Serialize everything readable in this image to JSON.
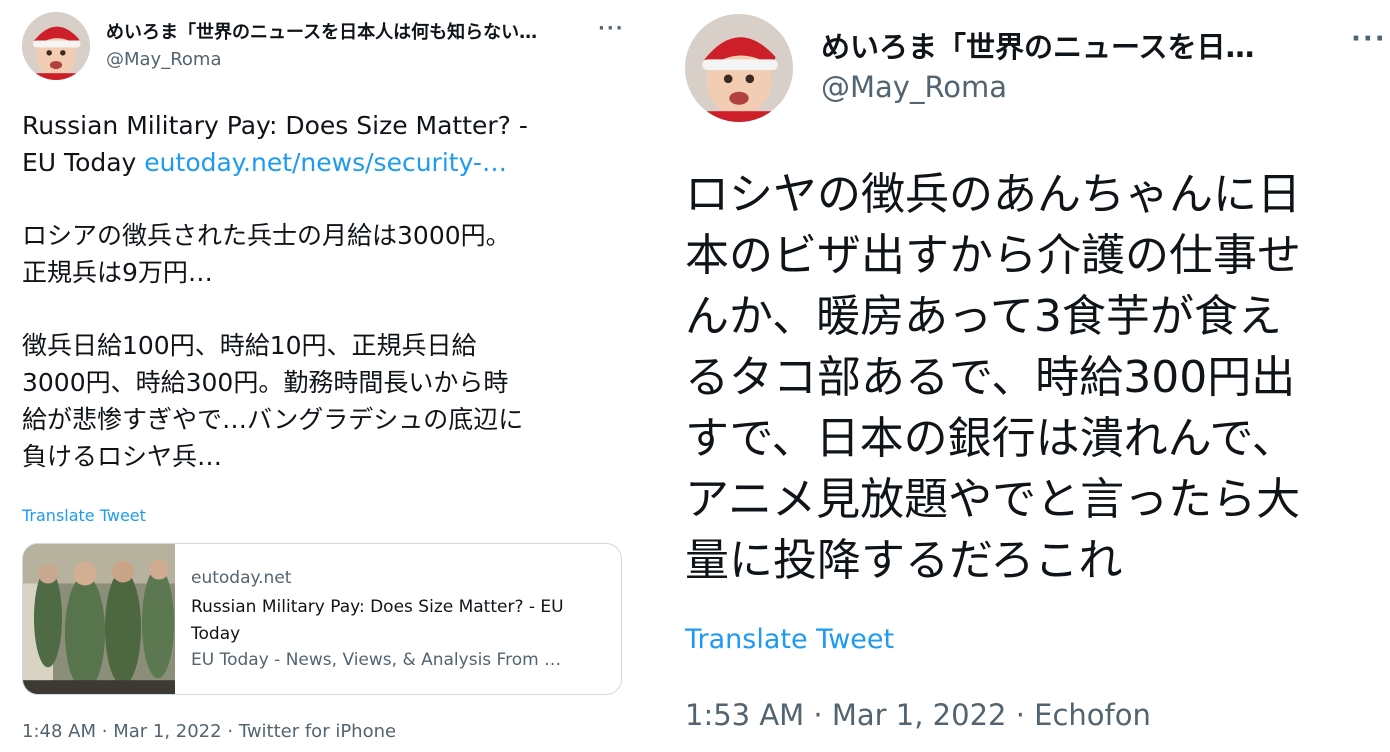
{
  "left_tweet": {
    "display_name": "めいろま「世界のニュースを日本人は何も知らない…",
    "handle": "@May_Roma",
    "more_icon": "more-horizontal-icon",
    "text_line1": "Russian Military Pay: Does Size Matter? -",
    "text_line2_plain": "EU Today ",
    "link_text": "eutoday.net/news/security-…",
    "para2_line1": "ロシアの徴兵された兵士の月給は3000円。",
    "para2_line2": "正規兵は9万円…",
    "para3_line1": "徴兵日給100円、時給10円、正規兵日給",
    "para3_line2": "3000円、時給300円。勤務時間長いから時",
    "para3_line3": "給が悲惨すぎやで…バングラデシュの底辺に",
    "para3_line4": "負けるロシヤ兵…",
    "translate_label": "Translate Tweet",
    "card": {
      "domain": "eutoday.net",
      "title": "Russian Military Pay: Does Size Matter? - EU Today",
      "description": "EU Today - News, Views, & Analysis From …"
    },
    "time": "1:48 AM",
    "date": "Mar 1, 2022",
    "client": "Twitter for iPhone",
    "separator": "·"
  },
  "right_tweet": {
    "display_name": "めいろま「世界のニュースを日…",
    "handle": "@May_Roma",
    "more_icon": "more-horizontal-icon",
    "line1": "ロシヤの徴兵のあんちゃんに日",
    "line2": "本のビザ出すから介護の仕事せ",
    "line3": "んか、暖房あって3食芋が食え",
    "line4": "るタコ部あるで、時給300円出",
    "line5": "すで、日本の銀行は潰れんで、",
    "line6": "アニメ見放題やでと言ったら大",
    "line7": "量に投降するだろこれ",
    "translate_label": "Translate Tweet",
    "time": "1:53 AM",
    "date": "Mar 1, 2022",
    "client": "Echofon",
    "separator": "·"
  },
  "colors": {
    "link": "#1d9bf0",
    "secondary_text": "#536471",
    "primary_text": "#0f1419",
    "card_border": "#cfd9de"
  }
}
